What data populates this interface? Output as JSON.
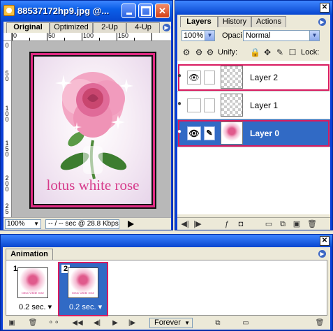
{
  "document": {
    "title": "88537172hp9.jpg @...",
    "tabs": [
      "Original",
      "Optimized",
      "2-Up",
      "4-Up"
    ],
    "ruler_h": [
      "0",
      "50",
      "100",
      "150"
    ],
    "ruler_v": [
      "0",
      "5",
      "0",
      "1",
      "0",
      "0",
      "1",
      "5",
      "0",
      "2",
      "0",
      "0",
      "2",
      "5"
    ],
    "image_caption": "lotus white rose",
    "zoom": "100%",
    "status": "-- / -- sec @ 28.8 Kbps"
  },
  "layers_panel": {
    "tabs": [
      "Layers",
      "History",
      "Actions"
    ],
    "opacity_value": "100%",
    "opacity_label": "Opaci",
    "blend_mode": "Normal",
    "unify_label": "Unify:",
    "lock_label": "Lock:",
    "layers": [
      {
        "name": "Layer 2",
        "visible": true,
        "selected": false
      },
      {
        "name": "Layer 1",
        "visible": false,
        "selected": false
      },
      {
        "name": "Layer 0",
        "visible": true,
        "selected": true
      }
    ]
  },
  "animation_panel": {
    "tab": "Animation",
    "frames": [
      {
        "number": "1",
        "delay": "0.2 sec."
      },
      {
        "number": "2",
        "delay": "0.2 sec."
      }
    ],
    "thumb_caption": "lotus white rose",
    "loop": "Forever"
  },
  "colors": {
    "xp_blue": "#0a3fd6",
    "selection": "#316ac5",
    "highlight_outline": "#d81b60",
    "caption_pink": "#d63a8a"
  }
}
